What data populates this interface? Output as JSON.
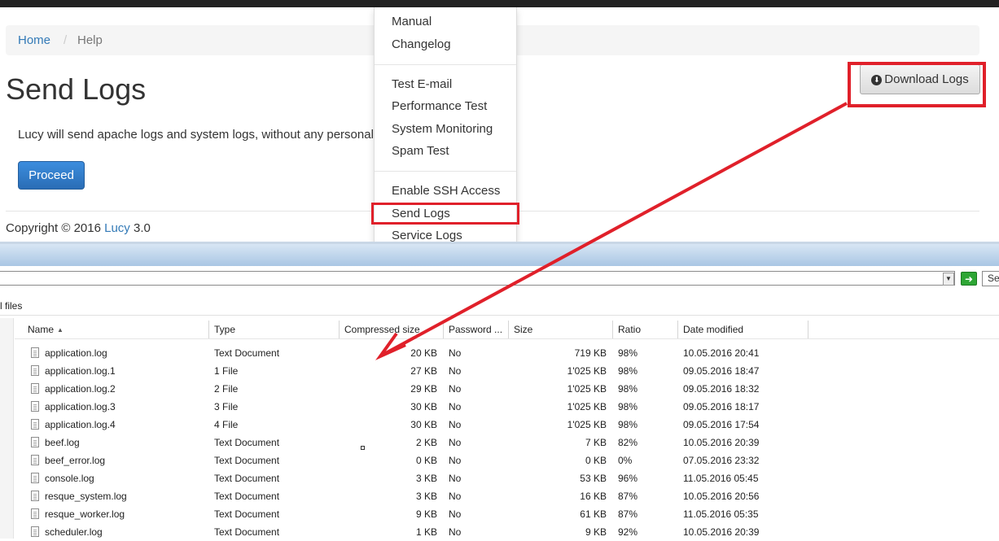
{
  "web": {
    "breadcrumb": {
      "home": "Home",
      "separator": "/",
      "current": "Help"
    },
    "title": "Send Logs",
    "description": "Lucy will send apache logs and system logs, without any personal c",
    "proceed_label": "Proceed",
    "copyright_prefix": "Copyright © 2016 ",
    "copyright_link": "Lucy",
    "copyright_suffix": " 3.0",
    "download_label": "Download Logs",
    "download_icon": "circle-arrow-down-icon"
  },
  "dropdown": {
    "items": [
      "Manual",
      "Changelog",
      "Test E-mail",
      "Performance Test",
      "System Monitoring",
      "Spam Test",
      "Enable SSH Access",
      "Send Logs",
      "Service Logs"
    ]
  },
  "explorer": {
    "search_placeholder": "Se",
    "files_label": "l files",
    "columns": [
      "Name",
      "Type",
      "Compressed size",
      "Password ...",
      "Size",
      "Ratio",
      "Date modified"
    ],
    "rows": [
      [
        "application.log",
        "Text Document",
        "20 KB",
        "No",
        "719 KB",
        "98%",
        "10.05.2016 20:41"
      ],
      [
        "application.log.1",
        "1 File",
        "27 KB",
        "No",
        "1'025 KB",
        "98%",
        "09.05.2016 18:47"
      ],
      [
        "application.log.2",
        "2 File",
        "29 KB",
        "No",
        "1'025 KB",
        "98%",
        "09.05.2016 18:32"
      ],
      [
        "application.log.3",
        "3 File",
        "30 KB",
        "No",
        "1'025 KB",
        "98%",
        "09.05.2016 18:17"
      ],
      [
        "application.log.4",
        "4 File",
        "30 KB",
        "No",
        "1'025 KB",
        "98%",
        "09.05.2016 17:54"
      ],
      [
        "beef.log",
        "Text Document",
        "2 KB",
        "No",
        "7 KB",
        "82%",
        "10.05.2016 20:39"
      ],
      [
        "beef_error.log",
        "Text Document",
        "0 KB",
        "No",
        "0 KB",
        "0%",
        "07.05.2016 23:32"
      ],
      [
        "console.log",
        "Text Document",
        "3 KB",
        "No",
        "53 KB",
        "96%",
        "11.05.2016 05:45"
      ],
      [
        "resque_system.log",
        "Text Document",
        "3 KB",
        "No",
        "16 KB",
        "87%",
        "10.05.2016 20:56"
      ],
      [
        "resque_worker.log",
        "Text Document",
        "9 KB",
        "No",
        "61 KB",
        "87%",
        "11.05.2016 05:35"
      ],
      [
        "scheduler.log",
        "Text Document",
        "1 KB",
        "No",
        "9 KB",
        "92%",
        "10.05.2016 20:39"
      ]
    ]
  },
  "colors": {
    "highlight": "#e0202a",
    "link": "#337ab7",
    "primary_button": "#2a6db5"
  }
}
